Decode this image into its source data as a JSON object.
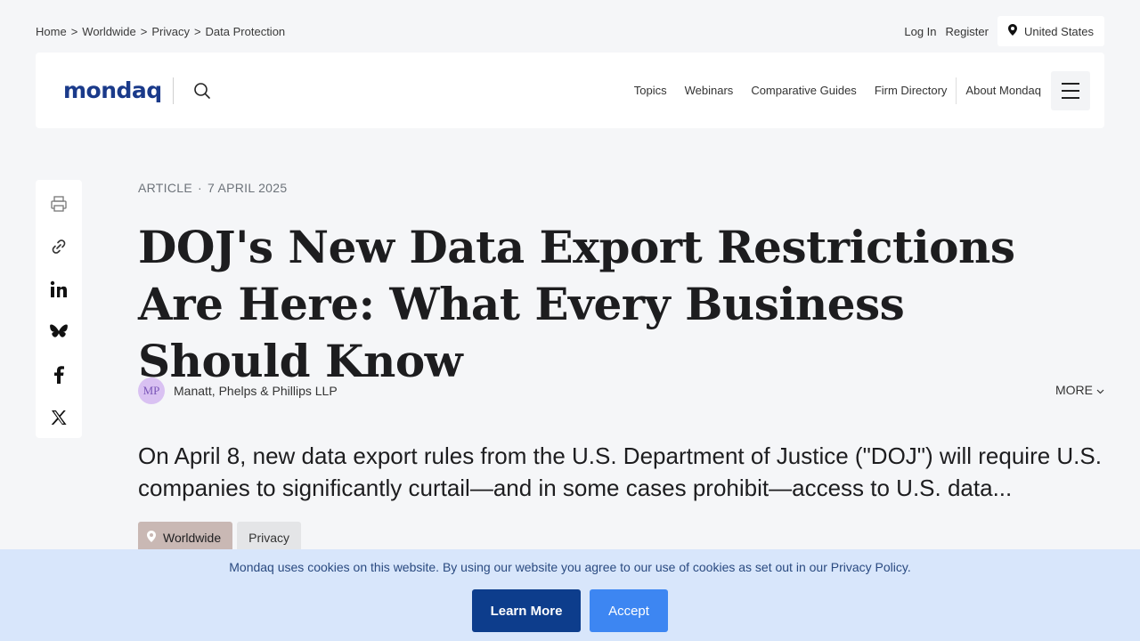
{
  "breadcrumb": [
    {
      "label": "Home"
    },
    {
      "label": "Worldwide"
    },
    {
      "label": "Privacy"
    },
    {
      "label": "Data Protection"
    }
  ],
  "breadcrumb_separator": ">",
  "util": {
    "login": "Log In",
    "register": "Register",
    "region": "United States",
    "region_icon": "location-pin-icon"
  },
  "header": {
    "logo": "mondaq",
    "search_icon": "search-icon",
    "nav": [
      {
        "label": "Topics"
      },
      {
        "label": "Webinars"
      },
      {
        "label": "Comparative Guides"
      },
      {
        "label": "Firm Directory"
      },
      {
        "label": "About Mondaq"
      }
    ],
    "menu_icon": "hamburger-menu-icon"
  },
  "share": {
    "icons": [
      "print-icon",
      "link-icon",
      "linkedin-icon",
      "bluesky-icon",
      "facebook-icon",
      "x-icon"
    ]
  },
  "article": {
    "type": "ARTICLE",
    "date": "7 APRIL 2025",
    "title": "DOJ's New Data Export Restrictions Are Here: What Every Business Should Know",
    "author_initials": "MP",
    "author": "Manatt, Phelps & Phillips LLP",
    "more": "MORE",
    "lede": "On April 8, new data export rules from the U.S. Department of Justice (\"DOJ\") will require U.S. companies to significantly curtail—and in some cases prohibit—access to U.S. data...",
    "tags": [
      {
        "label": "Worldwide"
      },
      {
        "label": "Privacy"
      }
    ]
  },
  "cookie": {
    "text": "Mondaq uses cookies on this website. By using our website you agree to our use of cookies as set out in our Privacy Policy.",
    "learn_more": "Learn More",
    "accept": "Accept"
  },
  "colors": {
    "background": "#f5f6f8",
    "brand": "#1a3a8a",
    "cookie_bg": "#d8e6fb",
    "learn_more_bg": "#0d3d8c",
    "accept_bg": "#3d86f2"
  }
}
